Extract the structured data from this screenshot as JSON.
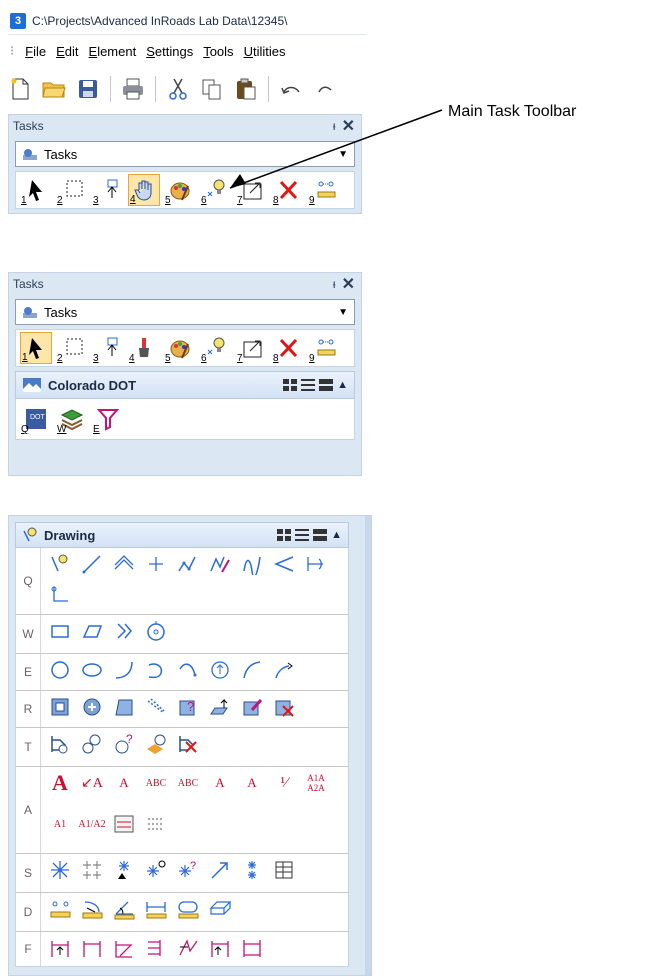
{
  "window": {
    "title": "C:\\Projects\\Advanced InRoads Lab Data\\12345\\",
    "menu": [
      "File",
      "Edit",
      "Element",
      "Settings",
      "Tools",
      "Utilities"
    ]
  },
  "tasks_panel_1": {
    "header": "Tasks",
    "dropdown_value": "Tasks",
    "tool_numbers": [
      "1",
      "2",
      "3",
      "4",
      "5",
      "6",
      "7",
      "8",
      "9"
    ]
  },
  "callout": {
    "text": "Main Task Toolbar"
  },
  "tasks_panel_2": {
    "header": "Tasks",
    "dropdown_value": "Tasks",
    "tool_numbers": [
      "1",
      "2",
      "3",
      "4",
      "5",
      "6",
      "7",
      "8",
      "9"
    ],
    "section_title": "Colorado DOT",
    "section_tool_letters": [
      "Q",
      "W",
      "E"
    ]
  },
  "drawing_panel": {
    "title": "Drawing",
    "rows": [
      {
        "key": "Q"
      },
      {
        "key": "W"
      },
      {
        "key": "E"
      },
      {
        "key": "R"
      },
      {
        "key": "T"
      },
      {
        "key": "A"
      },
      {
        "key": "S"
      },
      {
        "key": "D"
      },
      {
        "key": "F"
      }
    ],
    "text_tools": {
      "a1": "A",
      "a2": "A",
      "a3": "A",
      "a4": "ABC",
      "a5": "ABC",
      "a6": "A",
      "a7": "A",
      "a8": "A1A",
      "a9": "A2A",
      "a10": "A1",
      "a11": "A1",
      "a12": "A2"
    }
  },
  "colors": {
    "panel_bg": "#dce7f4",
    "accent": "#1e6fd1",
    "selected": "#fde6a9"
  }
}
